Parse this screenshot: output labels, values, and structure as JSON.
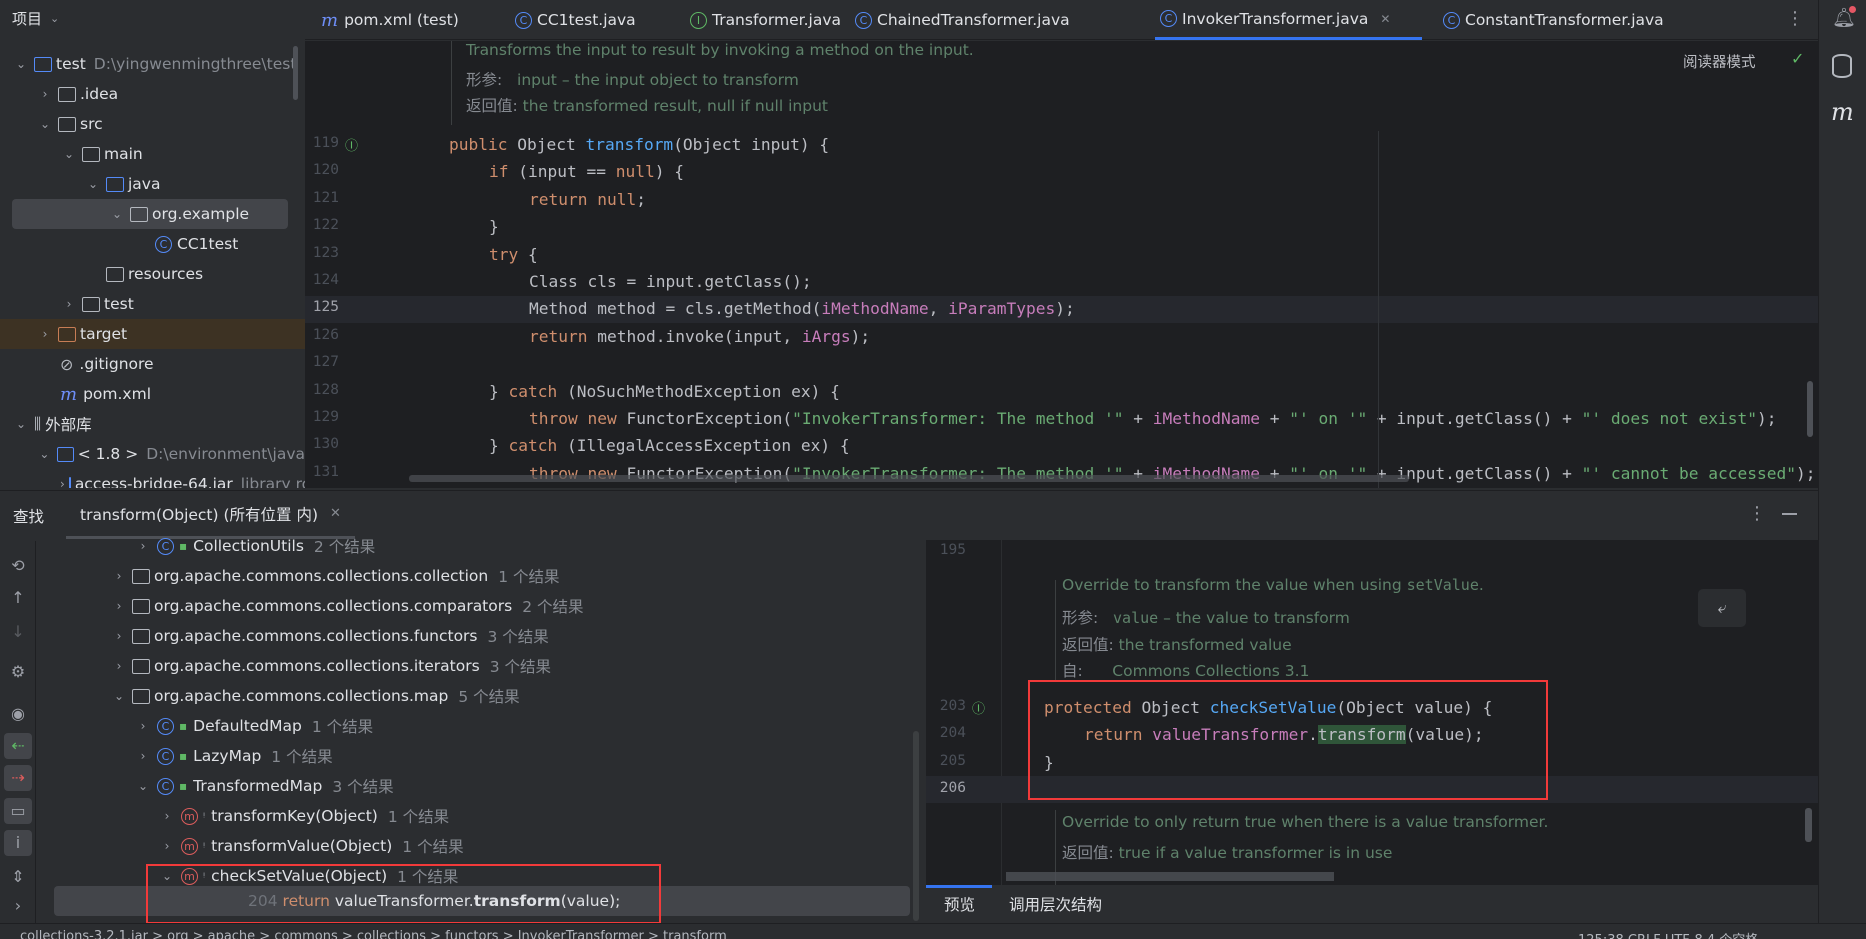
{
  "project": {
    "title": "项目",
    "items": [
      {
        "label": "test",
        "hint": "D:\\yingwenmingthree\\test",
        "level": 0,
        "chev": "v",
        "icon": "module"
      },
      {
        "label": ".idea",
        "level": 1,
        "chev": ">",
        "icon": "folder"
      },
      {
        "label": "src",
        "level": 1,
        "chev": "v",
        "icon": "folder"
      },
      {
        "label": "main",
        "level": 2,
        "chev": "v",
        "icon": "folder"
      },
      {
        "label": "java",
        "level": 3,
        "chev": "v",
        "icon": "folder-blue"
      },
      {
        "label": "org.example",
        "level": 4,
        "chev": "v",
        "icon": "package",
        "selected": true
      },
      {
        "label": "CC1test",
        "level": 5,
        "chev": "",
        "icon": "class"
      },
      {
        "label": "resources",
        "level": 3,
        "chev": "",
        "icon": "folder"
      },
      {
        "label": "test",
        "level": 2,
        "chev": ">",
        "icon": "folder"
      },
      {
        "label": "target",
        "level": 1,
        "chev": ">",
        "icon": "folder-orange",
        "highlight": true
      },
      {
        "label": ".gitignore",
        "level": 1,
        "chev": "",
        "icon": "ignore"
      },
      {
        "label": "pom.xml",
        "level": 1,
        "chev": "",
        "icon": "maven"
      },
      {
        "label": "外部库",
        "level": 0,
        "chev": "v",
        "icon": "library"
      },
      {
        "label": "< 1.8 >",
        "hint": "D:\\environment\\java",
        "level": 1,
        "chev": "v",
        "icon": "jdk"
      },
      {
        "label": "access-bridge-64.jar",
        "hint": "library root",
        "level": 2,
        "chev": ">",
        "icon": "jar"
      }
    ]
  },
  "tabs": [
    {
      "label": "pom.xml (test)",
      "icon": "maven"
    },
    {
      "label": "CC1test.java",
      "icon": "class"
    },
    {
      "label": "Transformer.java",
      "icon": "interface"
    },
    {
      "label": "ChainedTransformer.java",
      "icon": "class"
    },
    {
      "label": "InvokerTransformer.java",
      "icon": "class",
      "active": true
    },
    {
      "label": "ConstantTransformer.java",
      "icon": "class"
    }
  ],
  "editor": {
    "reader_mode": "阅读器模式",
    "doc": {
      "summary": "Transforms the input to result by invoking a method on the input.",
      "param_label": "形参:",
      "param": "input – the input object to transform",
      "return_label": "返回值:",
      "return": "the transformed result, null if null input"
    },
    "current_line": 125,
    "lines": [
      {
        "n": "119",
        "indent": 0,
        "t": [
          [
            "public ",
            "kw"
          ],
          [
            "Object ",
            "pl"
          ],
          [
            "transform",
            "fn"
          ],
          [
            "(Object input) {",
            "pl"
          ]
        ]
      },
      {
        "n": "120",
        "indent": 1,
        "t": [
          [
            "if ",
            "kw"
          ],
          [
            "(input == ",
            "pl"
          ],
          [
            "null",
            "kw"
          ],
          [
            ") {",
            "pl"
          ]
        ]
      },
      {
        "n": "121",
        "indent": 2,
        "t": [
          [
            "return null",
            "kw"
          ],
          [
            ";",
            "pl"
          ]
        ]
      },
      {
        "n": "122",
        "indent": 1,
        "t": [
          [
            "}",
            "pl"
          ]
        ]
      },
      {
        "n": "123",
        "indent": 1,
        "t": [
          [
            "try ",
            "kw"
          ],
          [
            "{",
            "pl"
          ]
        ]
      },
      {
        "n": "124",
        "indent": 2,
        "t": [
          [
            "Class cls = input.getClass();",
            "pl"
          ]
        ]
      },
      {
        "n": "125",
        "indent": 2,
        "t": [
          [
            "Method method = cls.getMethod(",
            "pl"
          ],
          [
            "iMethodName",
            "fld"
          ],
          [
            ", ",
            "pl"
          ],
          [
            "iParamTypes",
            "fld"
          ],
          [
            ");",
            "pl"
          ]
        ]
      },
      {
        "n": "126",
        "indent": 2,
        "t": [
          [
            "return ",
            "kw"
          ],
          [
            "method.invoke(input, ",
            "pl"
          ],
          [
            "iArgs",
            "fld"
          ],
          [
            ");",
            "pl"
          ]
        ]
      },
      {
        "n": "127",
        "indent": 0,
        "t": []
      },
      {
        "n": "128",
        "indent": 1,
        "t": [
          [
            "} ",
            "pl"
          ],
          [
            "catch ",
            "kw"
          ],
          [
            "(NoSuchMethodException ex) {",
            "pl"
          ]
        ]
      },
      {
        "n": "129",
        "indent": 2,
        "t": [
          [
            "throw new ",
            "kw"
          ],
          [
            "FunctorException(",
            "pl"
          ],
          [
            "\"InvokerTransformer: The method '\"",
            "str"
          ],
          [
            " + ",
            "pl"
          ],
          [
            "iMethodName",
            "fld"
          ],
          [
            " + ",
            "pl"
          ],
          [
            "\"' on '\"",
            "str"
          ],
          [
            " + input.getClass() + ",
            "pl"
          ],
          [
            "\"' does not exist\"",
            "str"
          ],
          [
            ");",
            "pl"
          ]
        ]
      },
      {
        "n": "130",
        "indent": 1,
        "t": [
          [
            "} ",
            "pl"
          ],
          [
            "catch ",
            "kw"
          ],
          [
            "(IllegalAccessException ex) {",
            "pl"
          ]
        ]
      },
      {
        "n": "131",
        "indent": 2,
        "t": [
          [
            "throw new ",
            "kw"
          ],
          [
            "FunctorException(",
            "pl"
          ],
          [
            "\"InvokerTransformer: The method '\"",
            "str"
          ],
          [
            " + ",
            "pl"
          ],
          [
            "iMethodName",
            "fld"
          ],
          [
            " + ",
            "pl"
          ],
          [
            "\"' on '\"",
            "str"
          ],
          [
            " + input.getClass() + ",
            "pl"
          ],
          [
            "\"' cannot be accessed\"",
            "str"
          ],
          [
            ");",
            "pl"
          ]
        ]
      }
    ]
  },
  "find": {
    "title": "查找",
    "tab": "transform(Object) (所有位置 内)",
    "rows": [
      {
        "level": 2,
        "chev": ">",
        "icon": "class",
        "label": "CollectionUtils",
        "count": "2 个结果"
      },
      {
        "level": 1,
        "chev": ">",
        "icon": "package",
        "label": "org.apache.commons.collections.collection",
        "count": "1 个结果"
      },
      {
        "level": 1,
        "chev": ">",
        "icon": "package",
        "label": "org.apache.commons.collections.comparators",
        "count": "2 个结果"
      },
      {
        "level": 1,
        "chev": ">",
        "icon": "package",
        "label": "org.apache.commons.collections.functors",
        "count": "3 个结果"
      },
      {
        "level": 1,
        "chev": ">",
        "icon": "package",
        "label": "org.apache.commons.collections.iterators",
        "count": "3 个结果"
      },
      {
        "level": 1,
        "chev": "v",
        "icon": "package",
        "label": "org.apache.commons.collections.map",
        "count": "5 个结果"
      },
      {
        "level": 2,
        "chev": ">",
        "icon": "class",
        "label": "DefaultedMap",
        "count": "1 个结果"
      },
      {
        "level": 2,
        "chev": ">",
        "icon": "class",
        "label": "LazyMap",
        "count": "1 个结果"
      },
      {
        "level": 2,
        "chev": "v",
        "icon": "class",
        "label": "TransformedMap",
        "count": "3 个结果"
      },
      {
        "level": 3,
        "chev": ">",
        "icon": "method",
        "label": "transformKey(Object)",
        "count": "1 个结果"
      },
      {
        "level": 3,
        "chev": ">",
        "icon": "method",
        "label": "transformValue(Object)",
        "count": "1 个结果"
      },
      {
        "level": 3,
        "chev": "v",
        "icon": "method",
        "label": "checkSetValue(Object)",
        "count": "1 个结果"
      }
    ],
    "result": {
      "line": "204",
      "kw": "return",
      "code_a": "valueTransformer.",
      "match": "transform",
      "code_b": "(value);"
    }
  },
  "preview": {
    "line_195": "195",
    "doc1": {
      "summary_a": "Override to transform the value when using ",
      "summary_code": "setValue",
      "summary_b": ".",
      "param_label": "形参:",
      "param_code": "value",
      "param": " – the value to transform",
      "return_label": "返回值:",
      "return": "the transformed value",
      "since_label": "自:",
      "since": "Commons Collections 3.1"
    },
    "lines": [
      {
        "n": "203",
        "indent": 0,
        "t": [
          [
            "protected ",
            "kw"
          ],
          [
            "Object ",
            "pl"
          ],
          [
            "checkSetValue",
            "fn"
          ],
          [
            "(Object value) {",
            "pl"
          ]
        ]
      },
      {
        "n": "204",
        "indent": 1,
        "t": [
          [
            "return ",
            "kw"
          ],
          [
            "valueTransformer",
            "fld"
          ],
          [
            ".",
            "pl"
          ],
          [
            "transform",
            "hlm"
          ],
          [
            "(value);",
            "pl"
          ]
        ]
      },
      {
        "n": "205",
        "indent": 0,
        "t": [
          [
            "}",
            "pl"
          ]
        ]
      },
      {
        "n": "206",
        "indent": 0,
        "t": []
      }
    ],
    "doc2": {
      "summary": "Override to only return true when there is a value transformer.",
      "return_label": "返回值:",
      "return": "true if a value transformer is in use"
    },
    "bottom_tabs": [
      "预览",
      "调用层次结构"
    ]
  },
  "status": {
    "breadcrumb": "collections-3.2.1.jar  >  org  >  apache  >  commons  >  collections  >  functors  >  InvokerTransformer  >  transform",
    "right": "125:38   CRLF   UTF-8   4 个空格"
  },
  "colors": {
    "accent": "#3574f0",
    "highlight_box": "#f23a3a",
    "keyword": "#cf8e6d",
    "method": "#56a8f5",
    "field": "#c77dbb",
    "string": "#6aab73",
    "doc": "#5f826b"
  }
}
